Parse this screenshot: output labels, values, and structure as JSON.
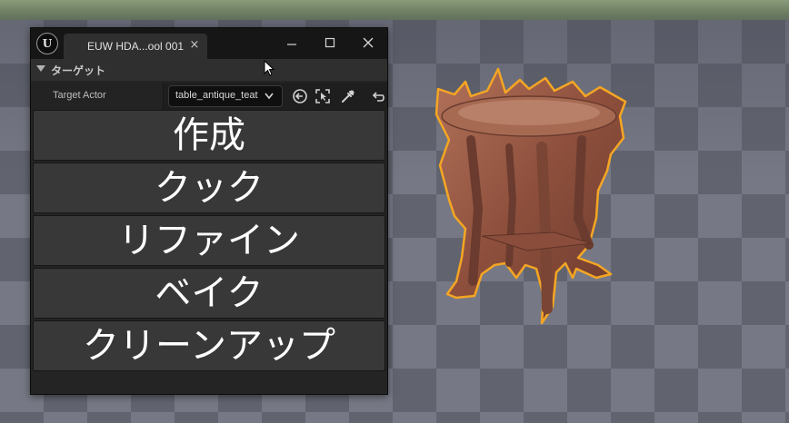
{
  "window": {
    "tab_title": "EUW HDA...ool 001",
    "tab_close": "×",
    "logo": "U"
  },
  "section": {
    "title": "ターゲット"
  },
  "property": {
    "label": "Target Actor",
    "value": "table_antique_teat",
    "icons": [
      "use-selected-icon",
      "browse-icon",
      "eyedropper-icon",
      "reset-icon"
    ]
  },
  "buttons": {
    "create": "作成",
    "cook": "クック",
    "refine": "リファイン",
    "bake": "ベイク",
    "cleanup": "クリーンアップ"
  },
  "colors": {
    "selection_outline": "#f5a623",
    "button_bg": "#383838",
    "panel_bg": "#242424"
  }
}
